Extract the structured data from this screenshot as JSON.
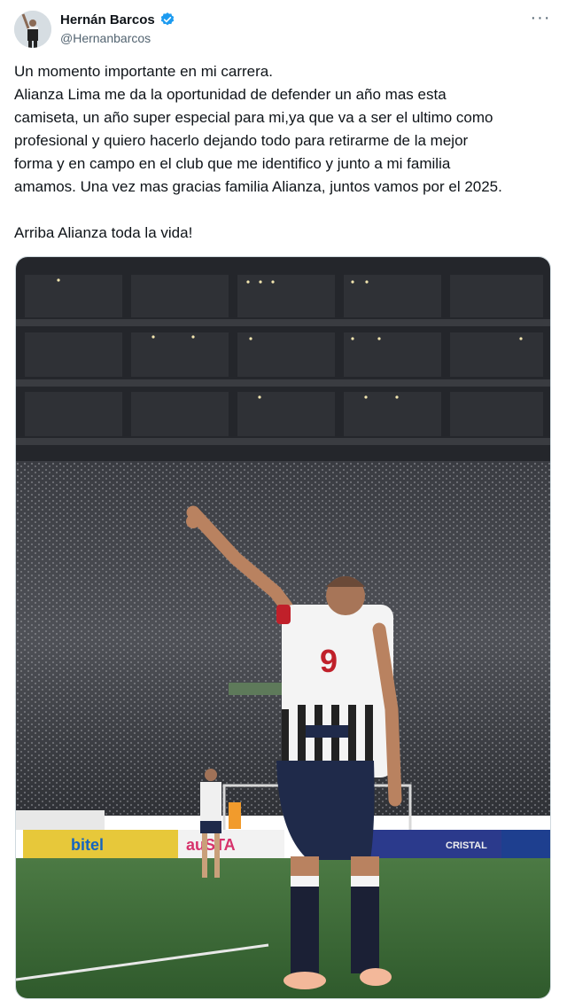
{
  "author": {
    "display_name": "Hernán Barcos",
    "handle": "@Hernanbarcos",
    "verified": true,
    "avatar_icon": "player-avatar-icon"
  },
  "menu_icon": "more-dots-icon",
  "tweet": {
    "line1": "Un momento importante en mi carrera.",
    "line2": "Alianza Lima me da la oportunidad de defender un año mas esta",
    "line3": "camiseta, un año super especial para mi,ya que va a ser el ultimo como",
    "line4": "profesional y quiero hacerlo dejando todo para retirarme de la mejor",
    "line5": "forma y en campo en el club que me identifico y junto a mi familia",
    "line6": "amamos. Una vez mas gracias familia Alianza, juntos vamos por el 2025.",
    "line7": "Arriba Alianza toda la vida!"
  },
  "photo": {
    "jersey_number": "9",
    "sponsors": [
      "bitel",
      "auSTA",
      "CRISTAL"
    ],
    "colors": {
      "pitch": "#3f6b3a",
      "shorts": "#1f2a4a",
      "stands": "#2b2d33",
      "accent_blue": "#1d9bf0"
    }
  }
}
